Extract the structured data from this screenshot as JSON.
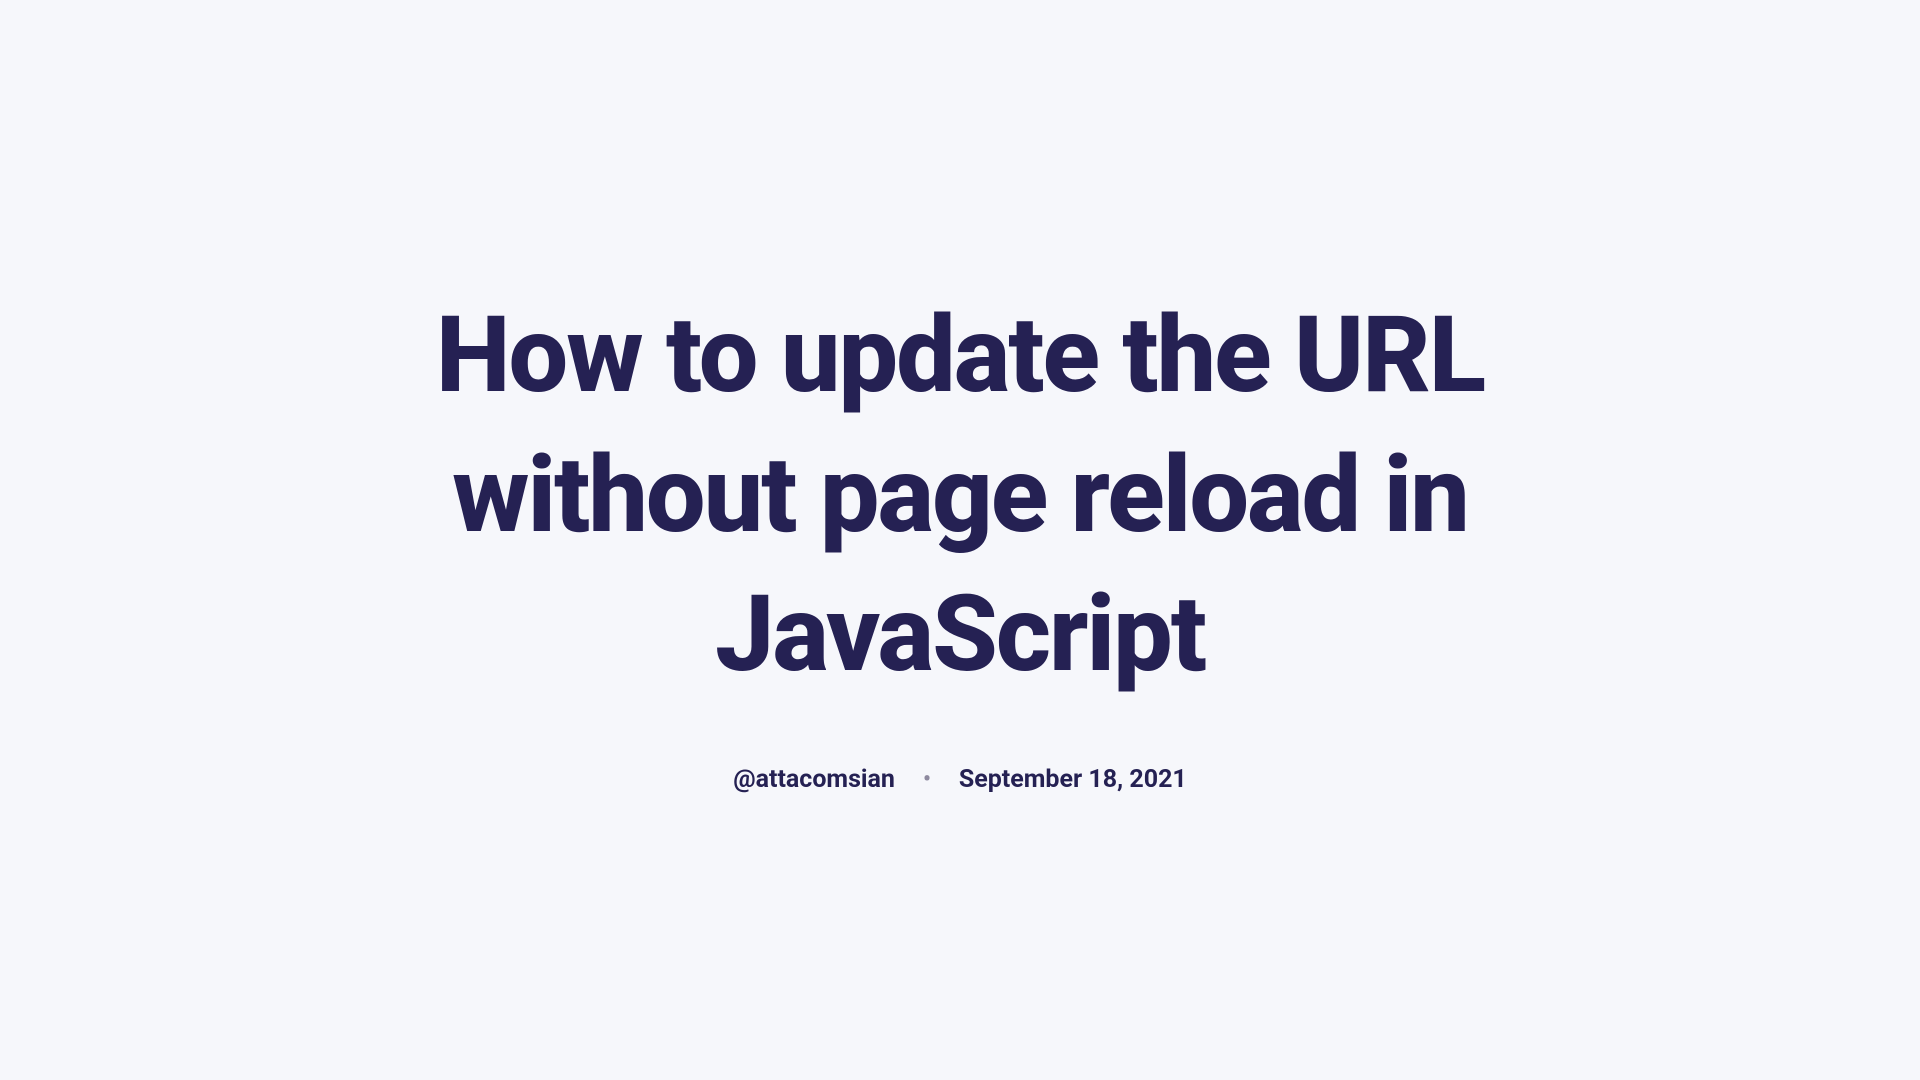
{
  "article": {
    "title": "How to update the URL without page reload in JavaScript",
    "author": "@attacomsian",
    "separator": "•",
    "date": "September 18, 2021"
  }
}
